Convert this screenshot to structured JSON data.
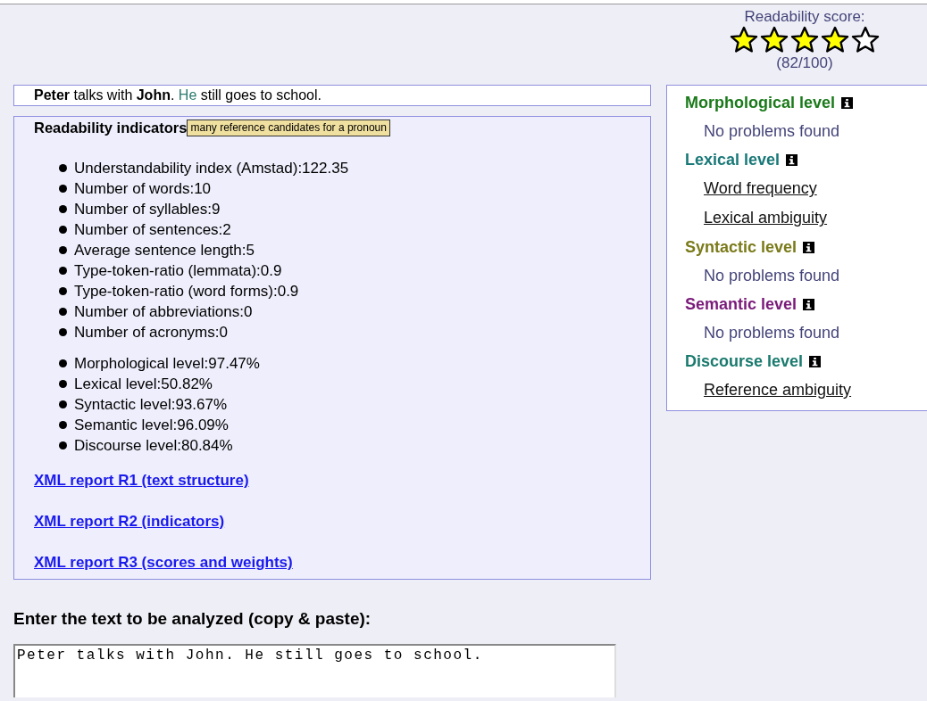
{
  "score": {
    "label": "Readability score:",
    "stars": 4,
    "value": "(82/100)"
  },
  "analyzed_text": {
    "before": "**Peter** talks with **John**.",
    "highlighted": "He",
    "after": "still goes to school."
  },
  "indicators": {
    "title": "Readability indicators",
    "tooltip": "many reference candidates for a pronoun",
    "groups": [
      [
        "Understandability index (Amstad):122.35",
        "Number of words:10",
        "Number of syllables:9",
        "Number of sentences:2",
        "Average sentence length:5",
        "Type-token-ratio (lemmata):0.9",
        "Type-token-ratio (word forms):0.9",
        "Number of abbreviations:0",
        "Number of acronyms:0"
      ],
      [
        "Morphological level:97.47%",
        "Lexical level:50.82%",
        "Syntactic level:93.67%",
        "Semantic level:96.09%",
        "Discourse level:80.84%"
      ]
    ],
    "links": [
      "XML report R1 (text structure)",
      "XML report R2 (indicators)",
      "XML report R3 (scores and weights)"
    ]
  },
  "levels": [
    {
      "name": "Morphological level",
      "color": "#1a7a1a",
      "items": [
        {
          "text": "No problems found",
          "kind": "note"
        }
      ]
    },
    {
      "name": "Lexical level",
      "color": "#1a7878",
      "items": [
        {
          "text": "Word frequency",
          "kind": "link"
        },
        {
          "text": "Lexical ambiguity",
          "kind": "link"
        }
      ]
    },
    {
      "name": "Syntactic level",
      "color": "#7a7a1a",
      "items": [
        {
          "text": "No problems found",
          "kind": "note"
        }
      ]
    },
    {
      "name": "Semantic level",
      "color": "#7a1a7a",
      "items": [
        {
          "text": "No problems found",
          "kind": "note"
        }
      ]
    },
    {
      "name": "Discourse level",
      "color": "#1a7a6e",
      "items": [
        {
          "text": "Reference ambiguity",
          "kind": "link"
        }
      ]
    }
  ],
  "input": {
    "label": "Enter the text to be analyzed (copy & paste):",
    "value": "Peter talks with John. He still goes to school."
  }
}
